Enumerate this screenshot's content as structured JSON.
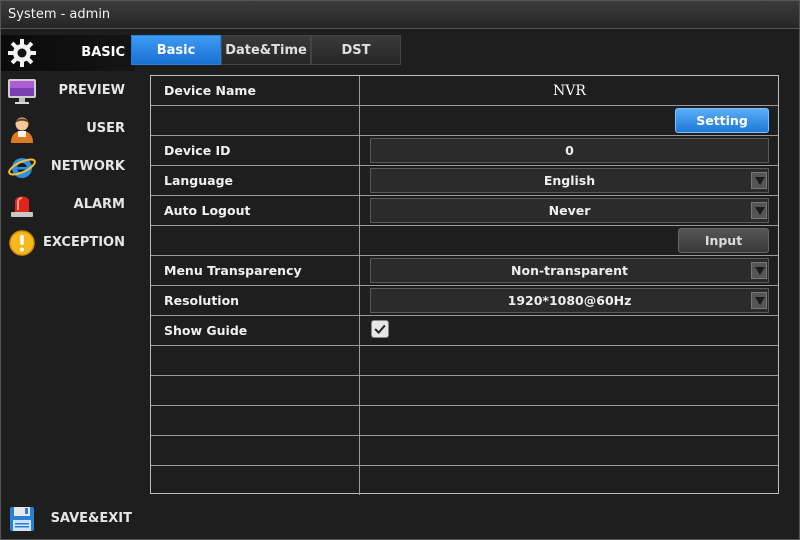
{
  "window": {
    "title": "System - admin"
  },
  "sidebar": {
    "items": [
      {
        "label": "BASIC",
        "icon": "gear-icon",
        "active": true
      },
      {
        "label": "PREVIEW",
        "icon": "monitor-icon",
        "active": false
      },
      {
        "label": "USER",
        "icon": "user-icon",
        "active": false
      },
      {
        "label": "NETWORK",
        "icon": "internet-explorer-icon",
        "active": false
      },
      {
        "label": "ALARM",
        "icon": "alarm-siren-icon",
        "active": false
      },
      {
        "label": "EXCEPTION",
        "icon": "exclamation-icon",
        "active": false
      }
    ],
    "save_exit": {
      "label": "SAVE&EXIT",
      "icon": "floppy-disk-icon"
    }
  },
  "tabs": [
    {
      "label": "Basic",
      "active": true
    },
    {
      "label": "Date&Time",
      "active": false
    },
    {
      "label": "DST",
      "active": false
    }
  ],
  "form": {
    "device_name": {
      "label": "Device Name",
      "value": "NVR"
    },
    "setting_button": {
      "label": "Setting"
    },
    "device_id": {
      "label": "Device ID",
      "value": "0"
    },
    "language": {
      "label": "Language",
      "value": "English"
    },
    "auto_logout": {
      "label": "Auto Logout",
      "value": "Never"
    },
    "input_button": {
      "label": "Input"
    },
    "menu_transparency": {
      "label": "Menu Transparency",
      "value": "Non-transparent"
    },
    "resolution": {
      "label": "Resolution",
      "value": "1920*1080@60Hz"
    },
    "show_guide": {
      "label": "Show Guide",
      "checked": true
    }
  },
  "colors": {
    "accent": "#1e78d8",
    "background": "#1e1e1e",
    "grid_line": "#9a9a9a"
  }
}
